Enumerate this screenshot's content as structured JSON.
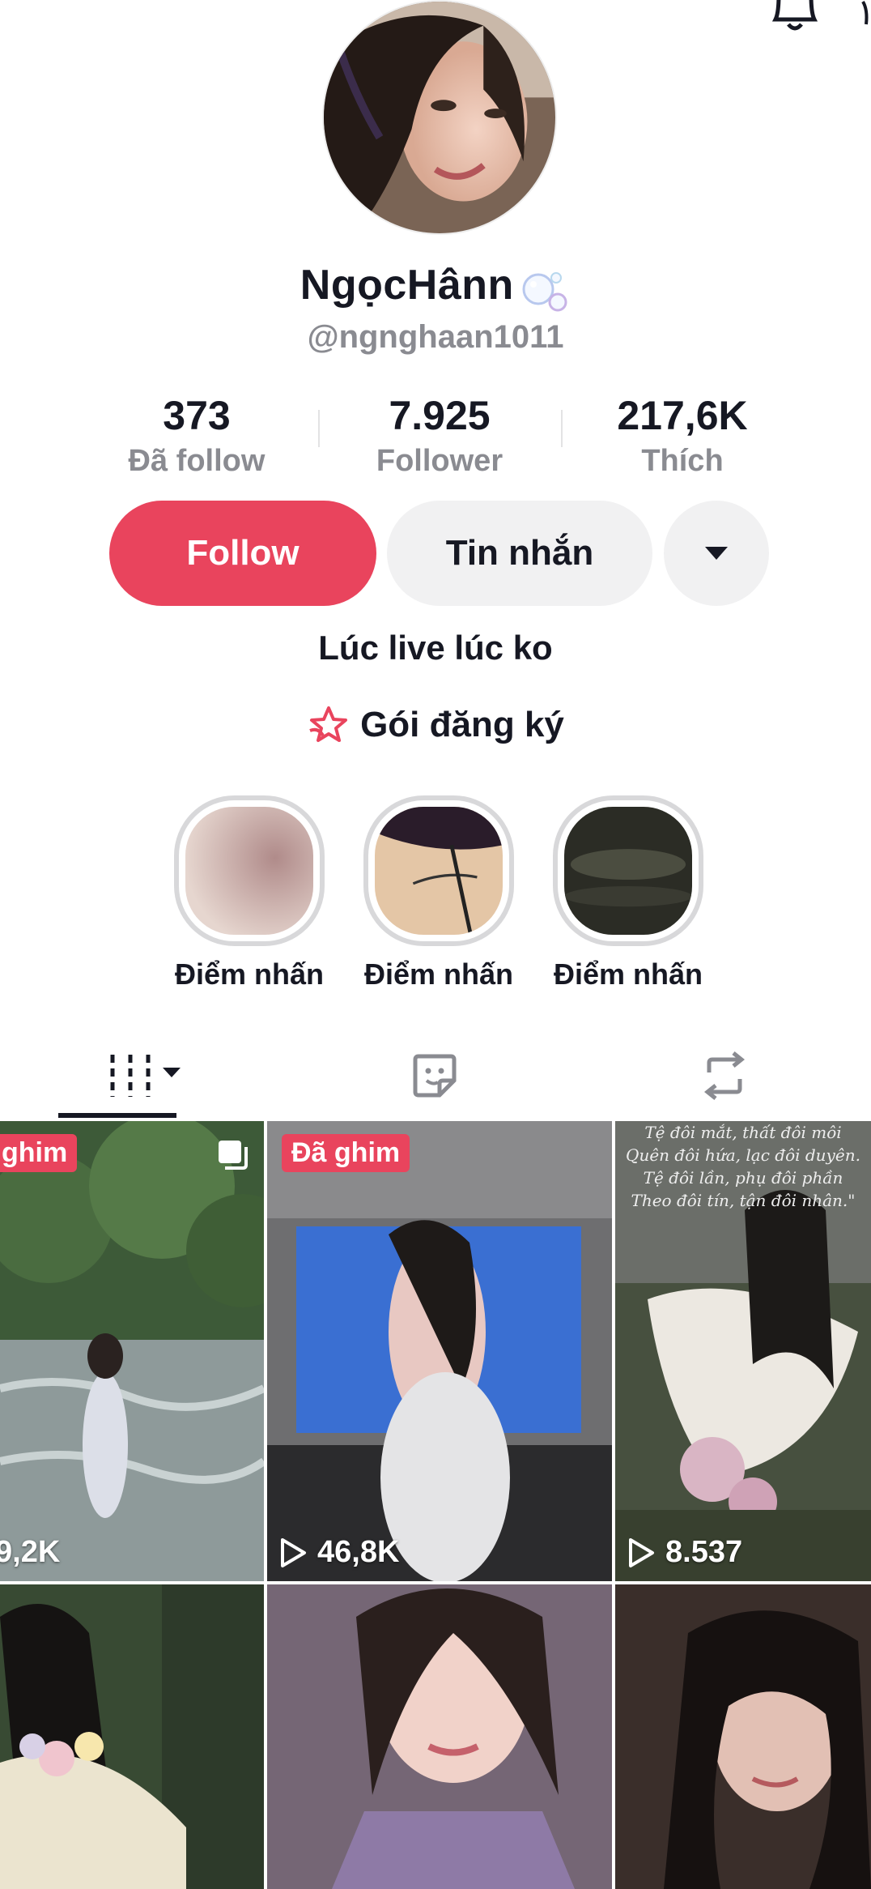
{
  "profile": {
    "display_name": "NgọcHânn",
    "handle": "@ngnghaan1011",
    "bio": "Lúc live lúc ko",
    "subscription_label": "Gói đăng ký"
  },
  "stats": [
    {
      "value": "373",
      "label": "Đã follow"
    },
    {
      "value": "7.925",
      "label": "Follower"
    },
    {
      "value": "217,6K",
      "label": "Thích"
    }
  ],
  "actions": {
    "follow_label": "Follow",
    "message_label": "Tin nhắn"
  },
  "highlights": [
    {
      "label": "Điểm nhấn"
    },
    {
      "label": "Điểm nhấn"
    },
    {
      "label": "Điểm nhấn"
    }
  ],
  "tabs": [
    {
      "icon": "grid-videos-icon",
      "active": true
    },
    {
      "icon": "sticker-icon",
      "active": false
    },
    {
      "icon": "repost-icon",
      "active": false
    }
  ],
  "videos": [
    {
      "badge": "ghim",
      "views": "9,2K",
      "multi": true
    },
    {
      "badge": "Đã ghim",
      "views": "46,8K"
    },
    {
      "badge": "",
      "views": "8.537",
      "caption": [
        "Tệ đôi mắt, thất đôi môi",
        "Quên đôi hứa, lạc đôi duyên.",
        "Tệ đôi lần, phụ đôi phần",
        "Theo đôi tín, tận đôi nhân.\""
      ]
    },
    {
      "badge": "",
      "views": ""
    },
    {
      "badge": "",
      "views": ""
    },
    {
      "badge": "",
      "views": ""
    }
  ],
  "colors": {
    "accent": "#e9445d",
    "text": "#161823",
    "muted": "#8a8b91",
    "button_bg": "#f1f1f2"
  }
}
